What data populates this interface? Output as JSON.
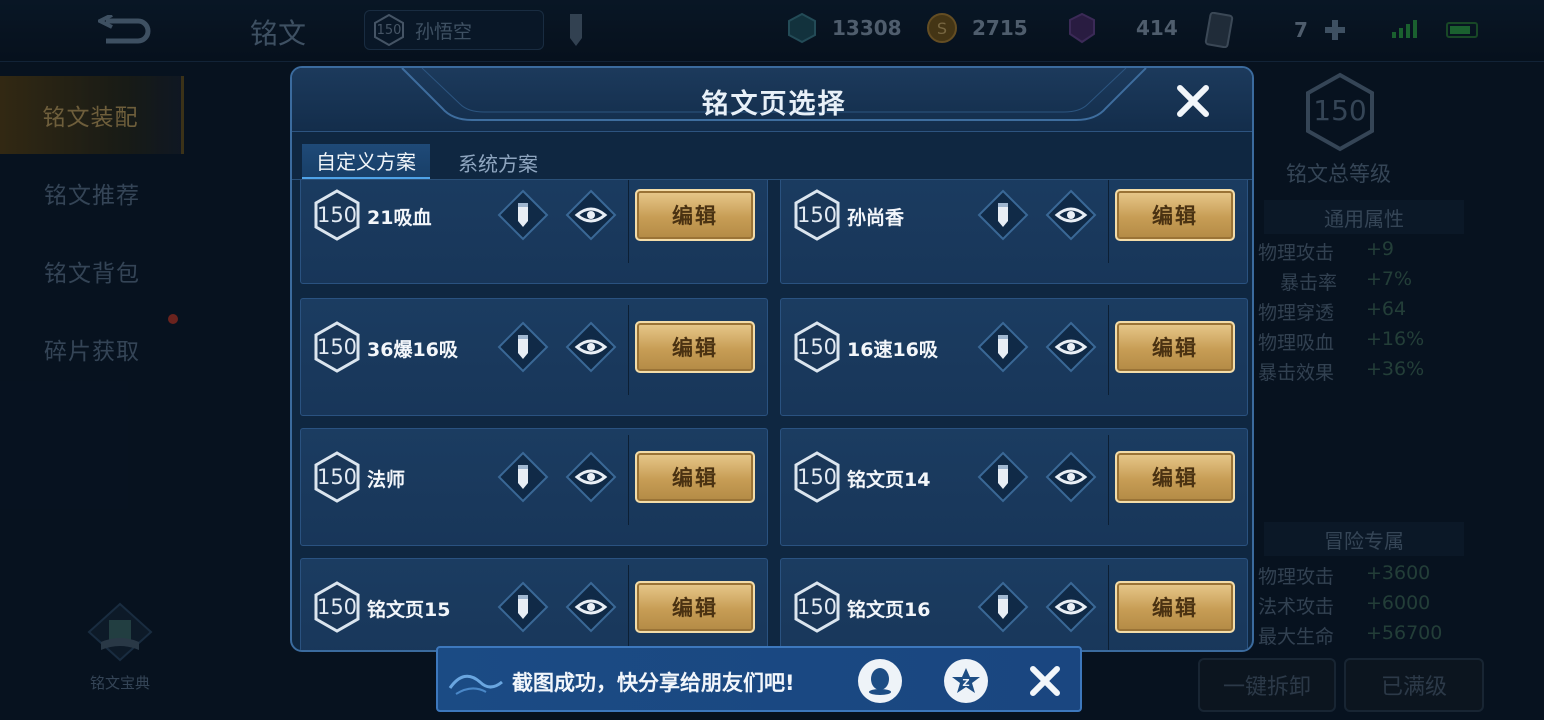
{
  "topbar": {
    "title": "铭文",
    "hero": {
      "level": "150",
      "name": "孙悟空"
    },
    "resources": [
      {
        "icon": "diamond-icon",
        "value": "13308"
      },
      {
        "icon": "coin-icon",
        "value": "2715"
      },
      {
        "icon": "crystal-icon",
        "value": "414"
      },
      {
        "icon": "card-icon",
        "value": "7"
      }
    ]
  },
  "sidebar": {
    "items": [
      {
        "label": "铭文装配",
        "active": true
      },
      {
        "label": "铭文推荐",
        "active": false
      },
      {
        "label": "铭文背包",
        "active": false
      },
      {
        "label": "碎片获取",
        "active": false
      }
    ],
    "codex_label": "铭文宝典"
  },
  "right_panel": {
    "total_level": "150",
    "total_label": "铭文总等级",
    "general_head": "通用属性",
    "general": [
      {
        "name": "物理攻击",
        "value": "+9"
      },
      {
        "name": "暴击率",
        "value": "+7%"
      },
      {
        "name": "物理穿透",
        "value": "+64"
      },
      {
        "name": "物理吸血",
        "value": "+16%"
      },
      {
        "name": "暴击效果",
        "value": "+36%"
      }
    ],
    "adventure_head": "冒险专属",
    "adventure": [
      {
        "name": "物理攻击",
        "value": "+3600"
      },
      {
        "name": "法术攻击",
        "value": "+6000"
      },
      {
        "name": "最大生命",
        "value": "+56700"
      }
    ],
    "unload_label": "一键拆卸",
    "maxed_label": "已满级"
  },
  "modal": {
    "title": "铭文页选择",
    "tabs": [
      {
        "label": "自定义方案",
        "active": true
      },
      {
        "label": "系统方案",
        "active": false
      }
    ],
    "edit_label": "编辑",
    "pages": [
      {
        "level": "150",
        "name": "21吸血"
      },
      {
        "level": "150",
        "name": "孙尚香"
      },
      {
        "level": "150",
        "name": "36爆16吸"
      },
      {
        "level": "150",
        "name": "16速16吸"
      },
      {
        "level": "150",
        "name": "法师"
      },
      {
        "level": "150",
        "name": "铭文页14"
      },
      {
        "level": "150",
        "name": "铭文页15"
      },
      {
        "level": "150",
        "name": "铭文页16"
      }
    ]
  },
  "toast": {
    "text": "截图成功，快分享给朋友们吧!"
  },
  "colors": {
    "accent_gold": "#c79d55",
    "modal_bg": "#0f2741",
    "card_bg": "#1b3c61",
    "toast_bg": "#1b4b84"
  }
}
